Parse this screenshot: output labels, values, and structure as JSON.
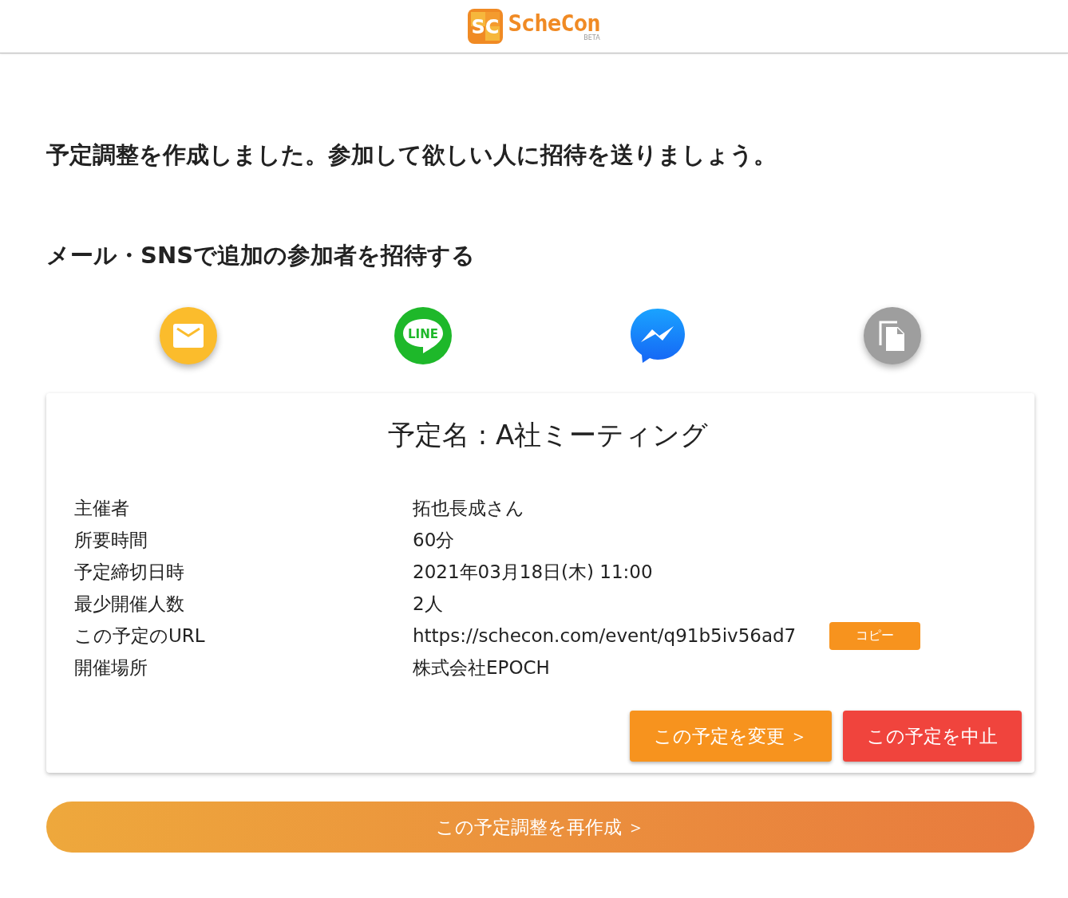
{
  "header": {
    "logo": {
      "mark": "SC",
      "name": "ScheCon",
      "badge": "BETA"
    }
  },
  "message": "予定調整を作成しました。参加して欲しい人に招待を送りましょう。",
  "invite_heading": "メール・SNSで追加の参加者を招待する",
  "share_buttons": [
    {
      "kind": "mail"
    },
    {
      "kind": "line",
      "label": "LINE"
    },
    {
      "kind": "messenger"
    },
    {
      "kind": "copy"
    }
  ],
  "card": {
    "title": "予定名 : A社ミーティング",
    "rows": [
      {
        "label": "主催者",
        "value": "拓也長成さん"
      },
      {
        "label": "所要時間",
        "value": "60分"
      },
      {
        "label": "予定締切日時",
        "value": "2021年03月18日(木) 11:00"
      },
      {
        "label": "最少開催人数",
        "value": "2人"
      },
      {
        "label": "この予定のURL",
        "value": "https://schecon.com/event/q91b5iv56ad7",
        "action": "コピー"
      },
      {
        "label": "開催場所",
        "value": "株式会社EPOCH"
      }
    ],
    "buttons": [
      {
        "kind": "edit",
        "label": "この予定を変更 ＞"
      },
      {
        "kind": "cancel",
        "label": "この予定を中止"
      }
    ]
  },
  "recreate_button": "この予定調整を再作成 ＞"
}
